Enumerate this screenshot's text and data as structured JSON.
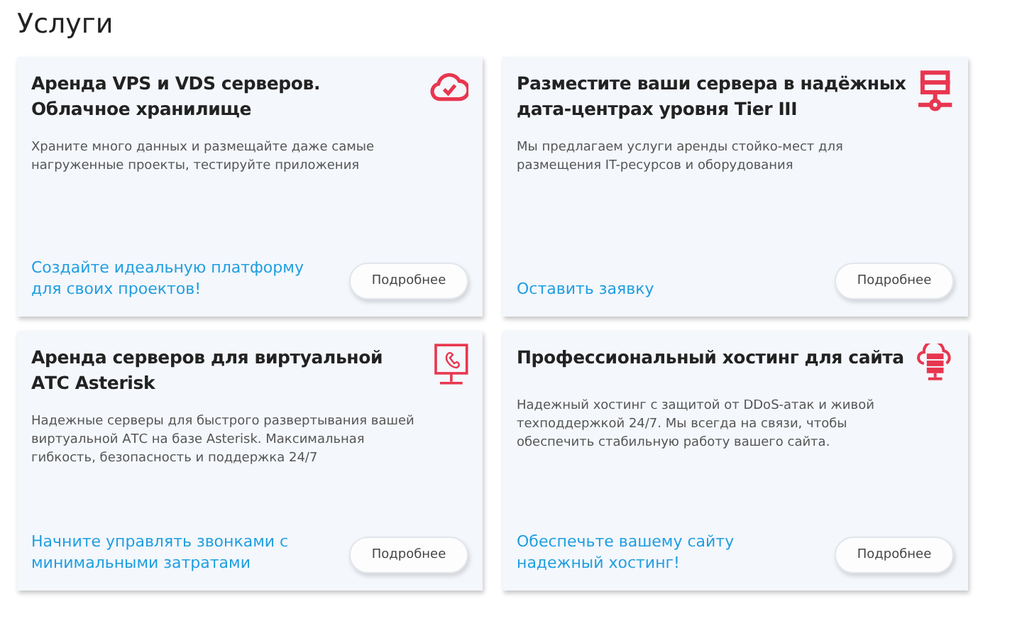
{
  "heading": "Услуги",
  "cards": [
    {
      "kind": "cloud",
      "title": "Аренда VPS и VDS серверов. Облачное хранилище",
      "description": "Храните много данных и размещайте даже самые нагруженные проекты, тестируйте приложения",
      "link": "Создайте идеальную платформу для своих проектов!",
      "button": "Подробнее"
    },
    {
      "kind": "network",
      "title": "Разместите ваши сервера в надёжных дата-центрах уровня Tier III",
      "description": "Мы предлагаем услуги аренды стойко-мест для размещения IT-ресурсов и оборудования",
      "link": "Оставить заявку",
      "button": "Подробнее"
    },
    {
      "kind": "telephony",
      "title": "Аренда серверов для виртуальной АТС Asterisk",
      "description": "Надежные серверы для быстрого развертывания вашей виртуальной АТС на базе Asterisk. Максимальная гибкость, безопасность и поддержка 24/7",
      "link": "Начните управлять звонками с минимальными затратами",
      "button": "Подробнее"
    },
    {
      "kind": "hosting",
      "title": "Профессиональный хостинг для сайта",
      "description": "Надежный хостинг с защитой от DDoS-атак и живой техподдержкой 24/7. Мы всегда на связи, чтобы обеспечить стабильную работу вашего сайта.",
      "link": "Обеспечьте вашему сайту надежный хостинг!",
      "button": "Подробнее"
    }
  ]
}
